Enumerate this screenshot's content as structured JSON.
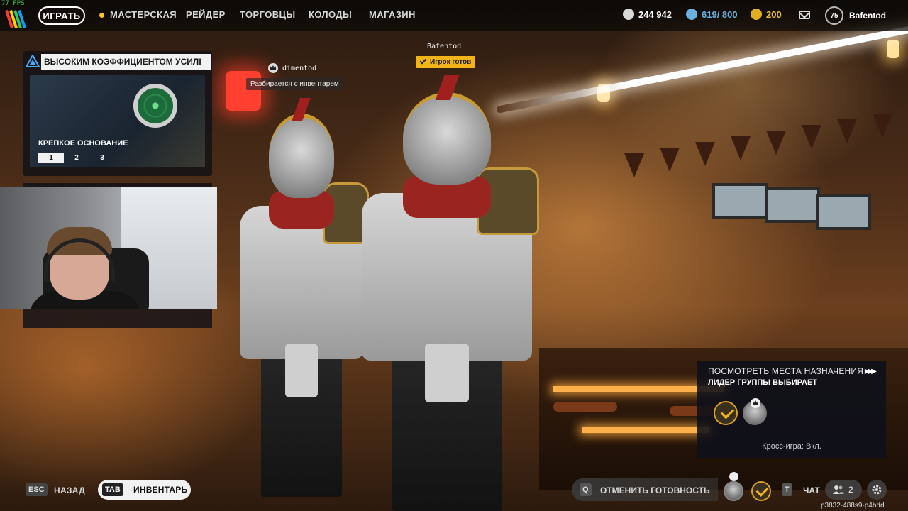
{
  "hud": {
    "fps": "77 FPS"
  },
  "topbar": {
    "play_label": "ИГРАТЬ",
    "nav": [
      "МАСТЕРСКАЯ",
      "РЕЙДЕР",
      "ТОРГОВЦЫ",
      "КОЛОДЫ",
      "МАГАЗИН"
    ],
    "currency_coins": "244 942",
    "currency_slots": "619/ 800",
    "currency_tokens": "200",
    "player_level": "75",
    "username": "Bafentod"
  },
  "quest": {
    "header": "ВЫСОКИМ КОЭФФИЦИЕНТОМ УСИЛІ",
    "title": "КРЕПКОЕ ОСНОВАНИЕ",
    "steps": [
      "1",
      "2",
      "3"
    ],
    "active_step": "1"
  },
  "players": {
    "left_name": "dimentod",
    "left_status": "Разбирается с инвентарем",
    "right_name": "Bafentod",
    "right_status": "Игрок готов"
  },
  "lobby": {
    "title": "ПОСМОТРЕТЬ МЕСТА НАЗНАЧЕНИЯ",
    "subtitle": "ЛИДЕР ГРУППЫ ВЫБИРАЕТ",
    "crossplay": "Кросс-игра: Вкл."
  },
  "bottombar": {
    "esc_key": "ESC",
    "back_label": "НАЗАД",
    "tab_key": "TAB",
    "inventory_label": "ИНВЕНТАРЬ",
    "cancel_key": "Q",
    "cancel_label": "ОТМЕНИТЬ ГОТОВНОСТЬ",
    "chat_key": "T",
    "chat_label": "ЧАТ",
    "party_count": "2",
    "build_id": "p3832-488s9-p4hdd"
  },
  "colors": {
    "accent_gold": "#f2b419",
    "nav_dot": "#f5c518",
    "currency_blue": "#6ab0e0",
    "token_gold": "#e0b020"
  }
}
